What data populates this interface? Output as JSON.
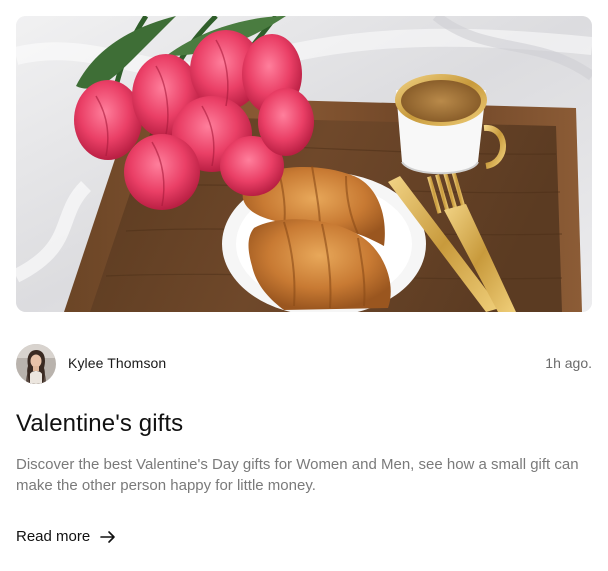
{
  "post": {
    "image_alt": "Breakfast tray with croissants, tea and pink tulips",
    "author": {
      "name": "Kylee Thomson",
      "avatar_icon": "avatar"
    },
    "time_ago": "1h ago.",
    "title": "Valentine's gifts",
    "description": "Discover the best Valentine's Day gifts for Women and Men, see how a small gift can make the other person happy for little money.",
    "read_more_label": "Read more",
    "read_more_icon": "arrow-right-icon"
  }
}
